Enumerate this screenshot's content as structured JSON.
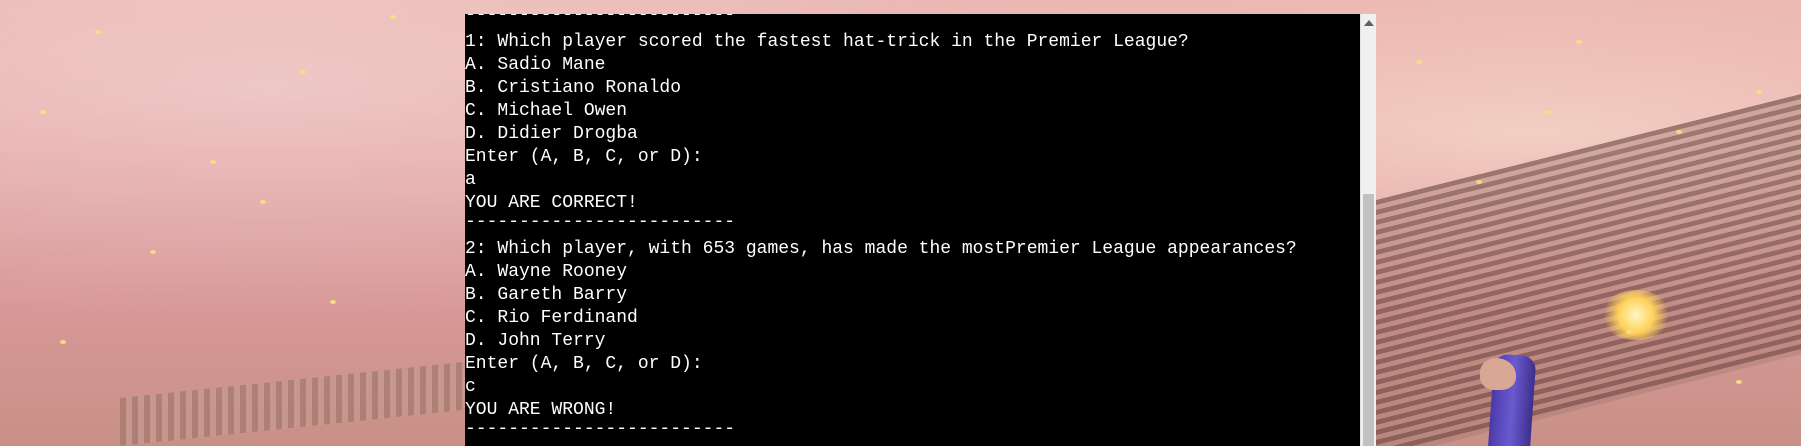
{
  "terminal": {
    "lines": [
      "-------------------------",
      "1: Which player scored the fastest hat-trick in the Premier League?",
      "A. Sadio Mane",
      "B. Cristiano Ronaldo",
      "C. Michael Owen",
      "D. Didier Drogba",
      "Enter (A, B, C, or D):",
      "a",
      "YOU ARE CORRECT!",
      "-------------------------",
      "2: Which player, with 653 games, has made the mostPremier League appearances?",
      "A. Wayne Rooney",
      "B. Gareth Barry",
      "C. Rio Ferdinand",
      "D. John Terry",
      "Enter (A, B, C, or D):",
      "c",
      "YOU ARE WRONG!",
      "-------------------------"
    ]
  },
  "colors": {
    "terminal_background": "#000000",
    "terminal_text": "#ffffff",
    "page_background": "#e3a3a3",
    "scrollbar_track": "#f0f0f0",
    "scrollbar_thumb": "#c1c1c1"
  },
  "icons": {
    "scroll_up": "scroll-up-arrow-icon"
  }
}
